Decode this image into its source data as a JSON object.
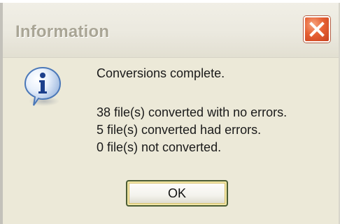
{
  "dialog": {
    "title": "Information",
    "message": {
      "heading": "Conversions complete.",
      "lines": [
        "38 file(s) converted with no errors.",
        "5 file(s) converted had errors.",
        "0 file(s) not converted."
      ]
    },
    "buttons": {
      "ok_label": "OK"
    },
    "icons": {
      "info": "info-icon",
      "close": "close-icon"
    },
    "colors": {
      "dialog_background": "#ece9d8",
      "close_button": "#e66134",
      "title_text": "#a9a595",
      "ok_focus_ring": "#d6c06d"
    }
  }
}
